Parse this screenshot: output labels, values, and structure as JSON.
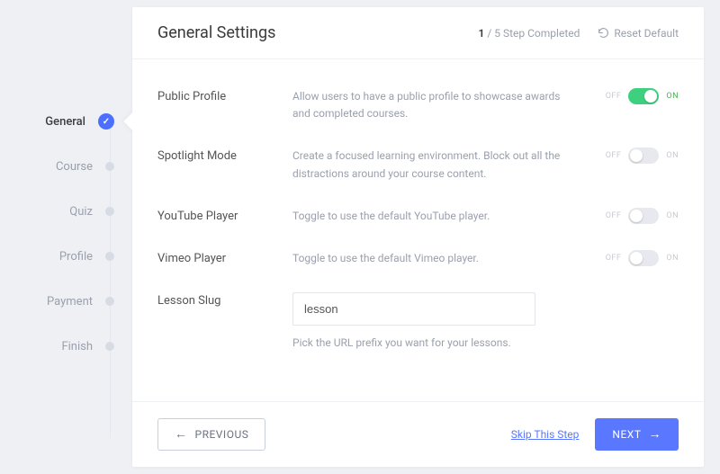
{
  "sidebar": {
    "items": [
      {
        "label": "General",
        "active": true
      },
      {
        "label": "Course",
        "active": false
      },
      {
        "label": "Quiz",
        "active": false
      },
      {
        "label": "Profile",
        "active": false
      },
      {
        "label": "Payment",
        "active": false
      },
      {
        "label": "Finish",
        "active": false
      }
    ]
  },
  "header": {
    "title": "General Settings",
    "step_current": "1",
    "step_total": "5",
    "step_suffix": " Step Completed",
    "reset_label": "Reset Default"
  },
  "settings": {
    "public_profile": {
      "label": "Public Profile",
      "description": "Allow users to have a public profile to showcase awards and completed courses.",
      "on": true
    },
    "spotlight": {
      "label": "Spotlight Mode",
      "description": "Create a focused learning environment. Block out all the distractions around your course content.",
      "on": false
    },
    "youtube": {
      "label": "YouTube Player",
      "description": "Toggle to use the default YouTube player.",
      "on": false
    },
    "vimeo": {
      "label": "Vimeo Player",
      "description": "Toggle to use the default Vimeo player.",
      "on": false
    },
    "lesson_slug": {
      "label": "Lesson Slug",
      "value": "lesson",
      "help": "Pick the URL prefix you want for your lessons."
    },
    "off_text": "OFF",
    "on_text": "ON"
  },
  "footer": {
    "previous": "PREVIOUS",
    "skip": "Skip This Step",
    "next": "NEXT"
  }
}
